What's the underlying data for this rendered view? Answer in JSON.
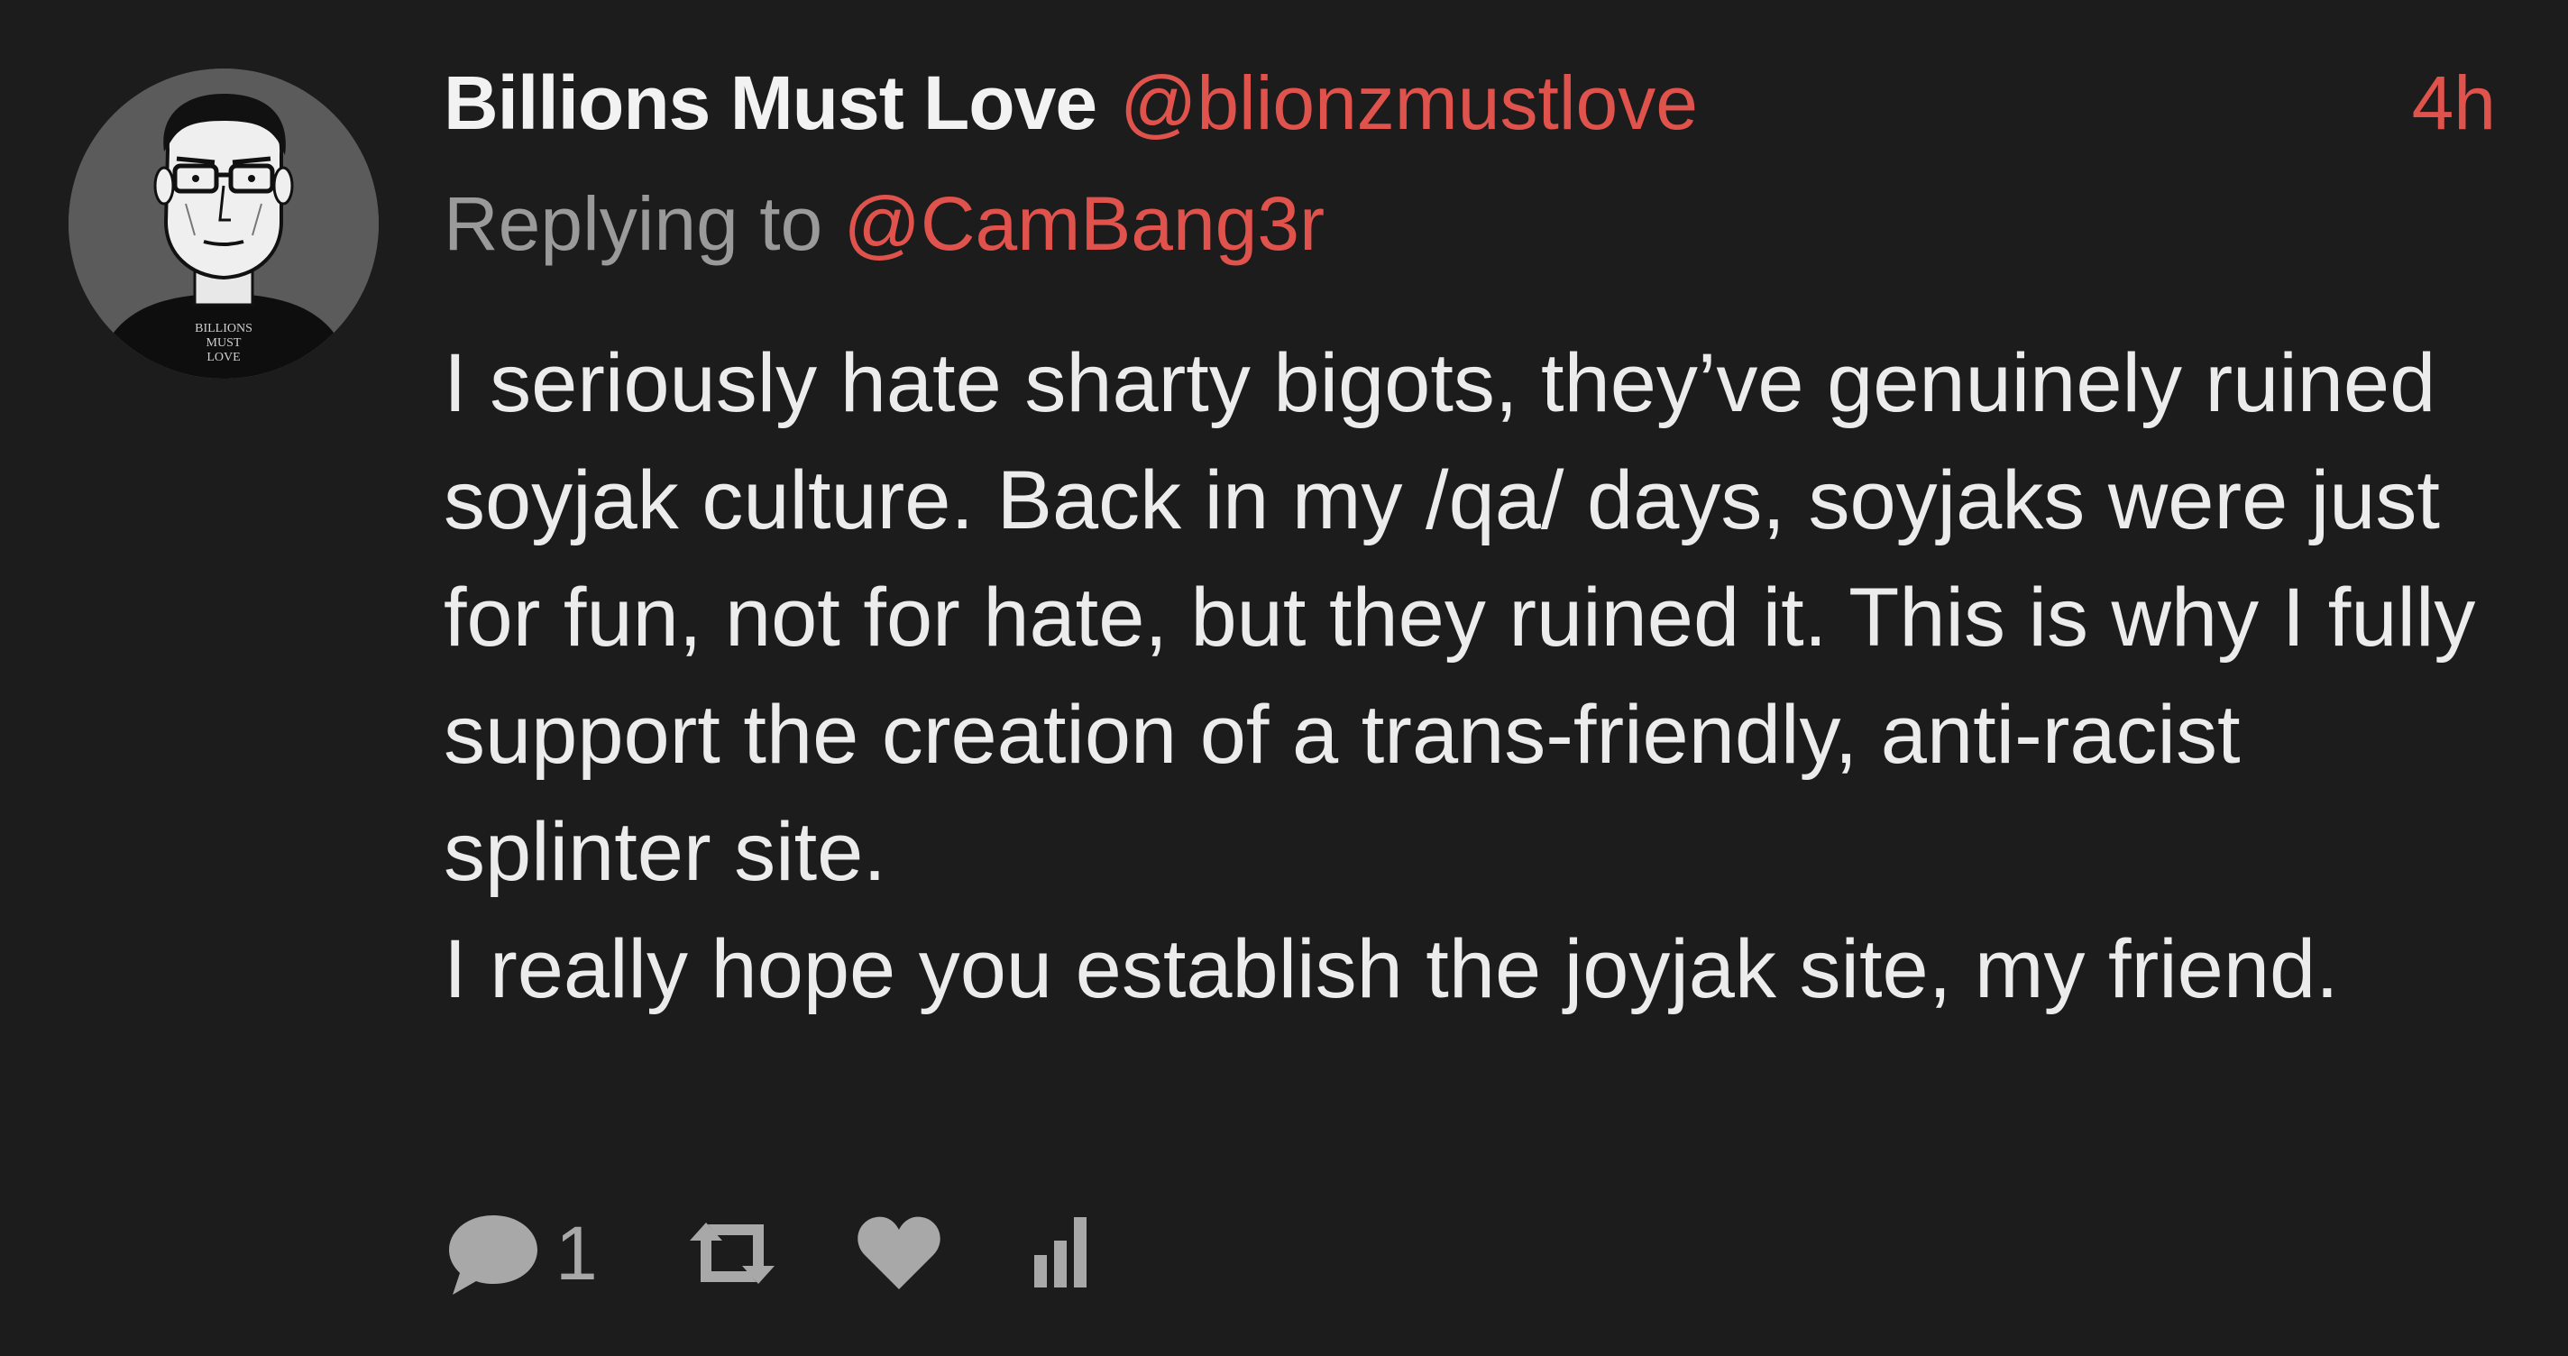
{
  "tweet": {
    "display_name": "Billions Must Love",
    "handle": "@blionzmustlove",
    "timestamp": "4h",
    "replying_to_label": "Replying to",
    "replying_to_handle": "@CamBang3r",
    "body_paragraphs": [
      "I seriously hate sharty bigots, they’ve genuinely ruined soyjak culture. Back in my /qa/ days, soyjaks were just for fun, not for hate, but they ruined it. This is why I fully support the creation of a trans-friendly, anti-racist splinter site.",
      "I really hope you establish the joyjak site, my friend."
    ],
    "avatar_shirt_text": [
      "BILLIONS",
      "MUST",
      "LOVE"
    ]
  },
  "actions": {
    "reply_count": "1",
    "icons": [
      "reply-icon",
      "retweet-icon",
      "like-icon",
      "analytics-icon"
    ]
  },
  "colors": {
    "background": "#1c1c1c",
    "accent": "#e0524c",
    "text": "#ececec",
    "muted": "#9a9a9a"
  }
}
